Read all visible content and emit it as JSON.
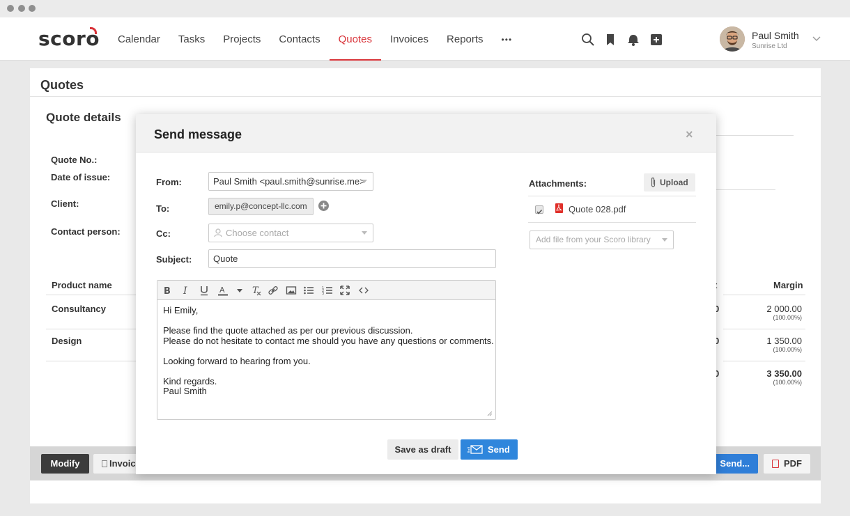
{
  "header": {
    "logo": "scoro",
    "nav": [
      "Calendar",
      "Tasks",
      "Projects",
      "Contacts",
      "Quotes",
      "Invoices",
      "Reports"
    ],
    "more": "•••",
    "user": {
      "name": "Paul Smith",
      "company": "Sunrise Ltd"
    }
  },
  "page": {
    "title": "Quotes",
    "section": "Quote details",
    "labels": {
      "quote_no": "Quote No.:",
      "date_of_issue": "Date of issue:",
      "client": "Client:",
      "contact_person": "Contact person:"
    },
    "table": {
      "col_product": "Product name",
      "col_cost_tail": "t",
      "col_margin": "Margin",
      "rows": [
        {
          "name": "Consultancy",
          "cost_tail": "0",
          "margin": "2 000.00",
          "pct": "(100.00%)"
        },
        {
          "name": "Design",
          "cost_tail": "0",
          "margin": "1 350.00",
          "pct": "(100.00%)"
        }
      ],
      "total": {
        "cost_tail": "0",
        "margin": "3 350.00",
        "pct": "(100.00%)"
      }
    },
    "bottom": {
      "modify": "Modify",
      "invoice": "Invoic",
      "send": "Send...",
      "pdf": "PDF"
    }
  },
  "modal": {
    "title": "Send message",
    "close": "×",
    "from_label": "From:",
    "from_value": "Paul Smith <paul.smith@sunrise.me>",
    "to_label": "To:",
    "to_chip": "emily.p@concept-llc.com",
    "cc_label": "Cc:",
    "cc_placeholder": "Choose contact",
    "subject_label": "Subject:",
    "subject_value": "Quote",
    "body": {
      "greeting": "Hi Emily,",
      "line1": "Please find the quote attached as per our previous discussion.",
      "line2": "Please do not hesitate to contact me should you have any questions or comments.",
      "line3": "Looking forward to hearing from you.",
      "closing": "Kind regards.",
      "signature": "Paul Smith"
    },
    "attachments_label": "Attachments:",
    "upload_label": "Upload",
    "attachment_file": "Quote 028.pdf",
    "library_placeholder": "Add file from your Scoro library",
    "save_draft": "Save as draft",
    "send": "Send"
  },
  "colors": {
    "accent": "#d9343a",
    "primary": "#2f86dc"
  }
}
